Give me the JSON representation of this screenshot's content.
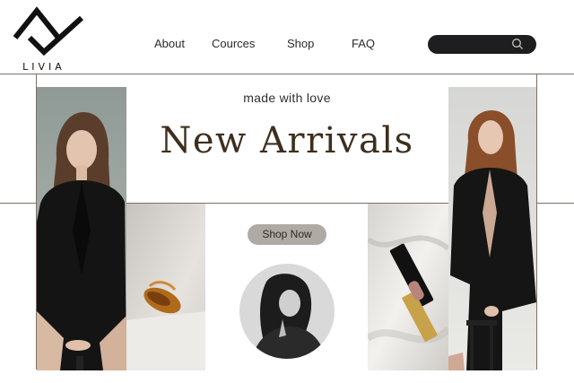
{
  "brand": {
    "name": "LIVIA",
    "logo_icon": "diamond-check-logo"
  },
  "nav": {
    "items": [
      {
        "label": "About"
      },
      {
        "label": "Cources"
      },
      {
        "label": "Shop"
      },
      {
        "label": "FAQ"
      }
    ]
  },
  "search": {
    "placeholder": "",
    "icon": "search-icon"
  },
  "hero": {
    "tagline": "made with love",
    "headline": "New Arrivals",
    "cta_label": "Shop Now"
  },
  "images": [
    {
      "name": "model-left-photo",
      "alt": "model in black blazer"
    },
    {
      "name": "hair-claw-photo",
      "alt": "amber hair claw clip"
    },
    {
      "name": "model-circle-photo",
      "alt": "monochrome portrait of model"
    },
    {
      "name": "lipstick-photo",
      "alt": "nude lipstick on satin"
    },
    {
      "name": "model-right-photo",
      "alt": "model in black suit"
    }
  ],
  "colors": {
    "headline": "#3d2e1e",
    "button": "#b0aaa4",
    "search_bg": "#1e1e21",
    "frame_line": "#7a7068"
  }
}
